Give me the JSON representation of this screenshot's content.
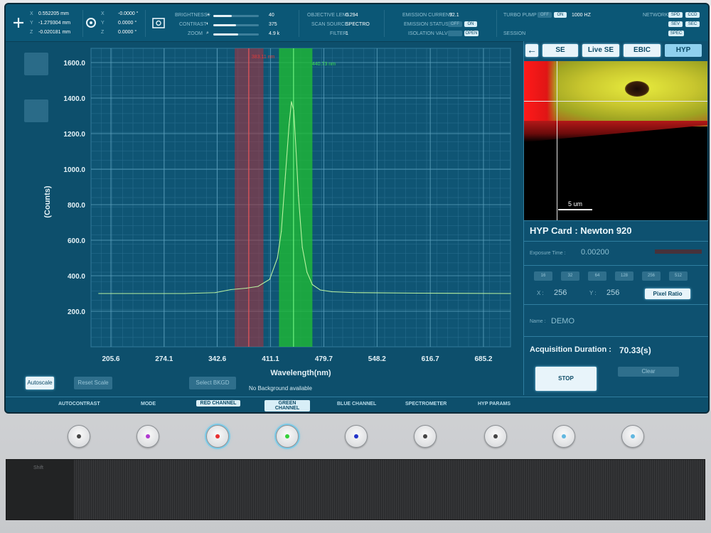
{
  "top_bar": {
    "position": {
      "x_label": "X",
      "x_value": "0.552205 mm",
      "y_label": "Y",
      "y_value": "-1.279304 mm",
      "z_label": "Z",
      "z_value": "-0.020181 mm"
    },
    "rotation": {
      "x_label": "X",
      "x_value": "-0.0000 °",
      "y_label": "Y",
      "y_value": "0.0000 °",
      "z_label": "Z",
      "z_value": "0.0000 °"
    },
    "brightness_label": "BRIGHTNESS",
    "brightness_value": "40",
    "brightness_level": 0.4,
    "contrast_label": "CONTRAST",
    "contrast_value": "375",
    "contrast_level": 0.5,
    "zoom_label": "ZOOM",
    "zoom_value": "4.9 k",
    "zoom_level": 0.55,
    "objective_lens_label": "OBJECTIVE LENS",
    "objective_lens_value": "0.294",
    "scan_source_label": "SCAN SOURCE",
    "scan_source_value": "SPECTRO",
    "filter_label": "FILTER",
    "filter_value": "1",
    "emission_current_label": "EMISSION CURRENT",
    "emission_current_value": "92.1",
    "emission_status_label": "EMISSION STATUS",
    "isolation_valve_label": "ISOLATION VALVE",
    "off_label": "OFF",
    "on_label": "ON",
    "open_label": "OPEN",
    "turbo_pump_label": "TURBO PUMP",
    "turbo_pump_value": "1000 HZ",
    "session_label": "SESSION",
    "network_label": "NETWORK",
    "network_buttons": [
      "SPD",
      "CCD",
      "SEV",
      "SEC",
      "SPEC"
    ]
  },
  "chart_data": {
    "type": "line",
    "xlabel": "Wavelength(nm)",
    "ylabel": "(Counts)",
    "x_ticks": [
      "205.6",
      "274.1",
      "342.6",
      "411.1",
      "479.7",
      "548.2",
      "616.7",
      "685.2"
    ],
    "y_ticks": [
      "200.0",
      "400.0",
      "600.0",
      "800.0",
      "1000.0",
      "1200.0",
      "1400.0",
      "1600.0"
    ],
    "xlim": [
      180,
      720
    ],
    "ylim": [
      0,
      1680
    ],
    "series": [
      {
        "color": "#b9f2a0",
        "x": [
          190,
          300,
          340,
          360,
          380,
          395,
          410,
          420,
          425,
          430,
          435,
          438,
          441,
          444,
          447,
          452,
          458,
          465,
          475,
          490,
          520,
          600,
          720
        ],
        "y": [
          300,
          300,
          305,
          322,
          330,
          340,
          380,
          500,
          650,
          950,
          1250,
          1380,
          1330,
          1100,
          850,
          560,
          420,
          350,
          320,
          310,
          305,
          302,
          300
        ]
      }
    ],
    "red_marker_label": "383.11 nm",
    "green_marker_label": "440.73 nm",
    "red_band": [
      365,
      402
    ],
    "green_band": [
      422,
      465
    ],
    "red_center": 383.11,
    "green_center": 440.73
  },
  "plot_controls": {
    "autoscale": "Autoscale",
    "reset_scale": "Reset Scale",
    "select_bkgd": "Select BKGD",
    "no_background": "No Background available"
  },
  "image_panel": {
    "back_icon": "back-arrow-icon",
    "tabs": [
      "SE",
      "Live SE",
      "EBIC",
      "HYP"
    ],
    "scale_bar_label": "5 um"
  },
  "hyp_card": {
    "title": "HYP Card : Newton 920",
    "exposure_label": "Exposure Time :",
    "exposure_value": "0.00200",
    "binning_options": [
      "16",
      "32",
      "64",
      "128",
      "256",
      "512"
    ],
    "x_label": "X :",
    "x_value": "256",
    "y_label": "Y :",
    "y_value": "256",
    "pixel_ratio": "Pixel Ratio",
    "name_label": "Name :",
    "name_value": "DEMO",
    "acq_label": "Acquisition Duration :",
    "acq_value": "70.33(s)",
    "stop": "STOP",
    "clear": "Clear"
  },
  "bottom_tabs": [
    "AUTOCONTRAST",
    "MODE",
    "RED CHANNEL",
    "GREEN CHANNEL",
    "BLUE CHANNEL",
    "SPECTROMETER",
    "HYP PARAMS"
  ],
  "knob_colors": [
    "#444444",
    "#b03ad1",
    "#e83030",
    "#35d13a",
    "#2233c8",
    "#444444",
    "#444444",
    "#62b8e0",
    "#62b8e0"
  ],
  "keyboard": {
    "shift_label": "Shift"
  }
}
